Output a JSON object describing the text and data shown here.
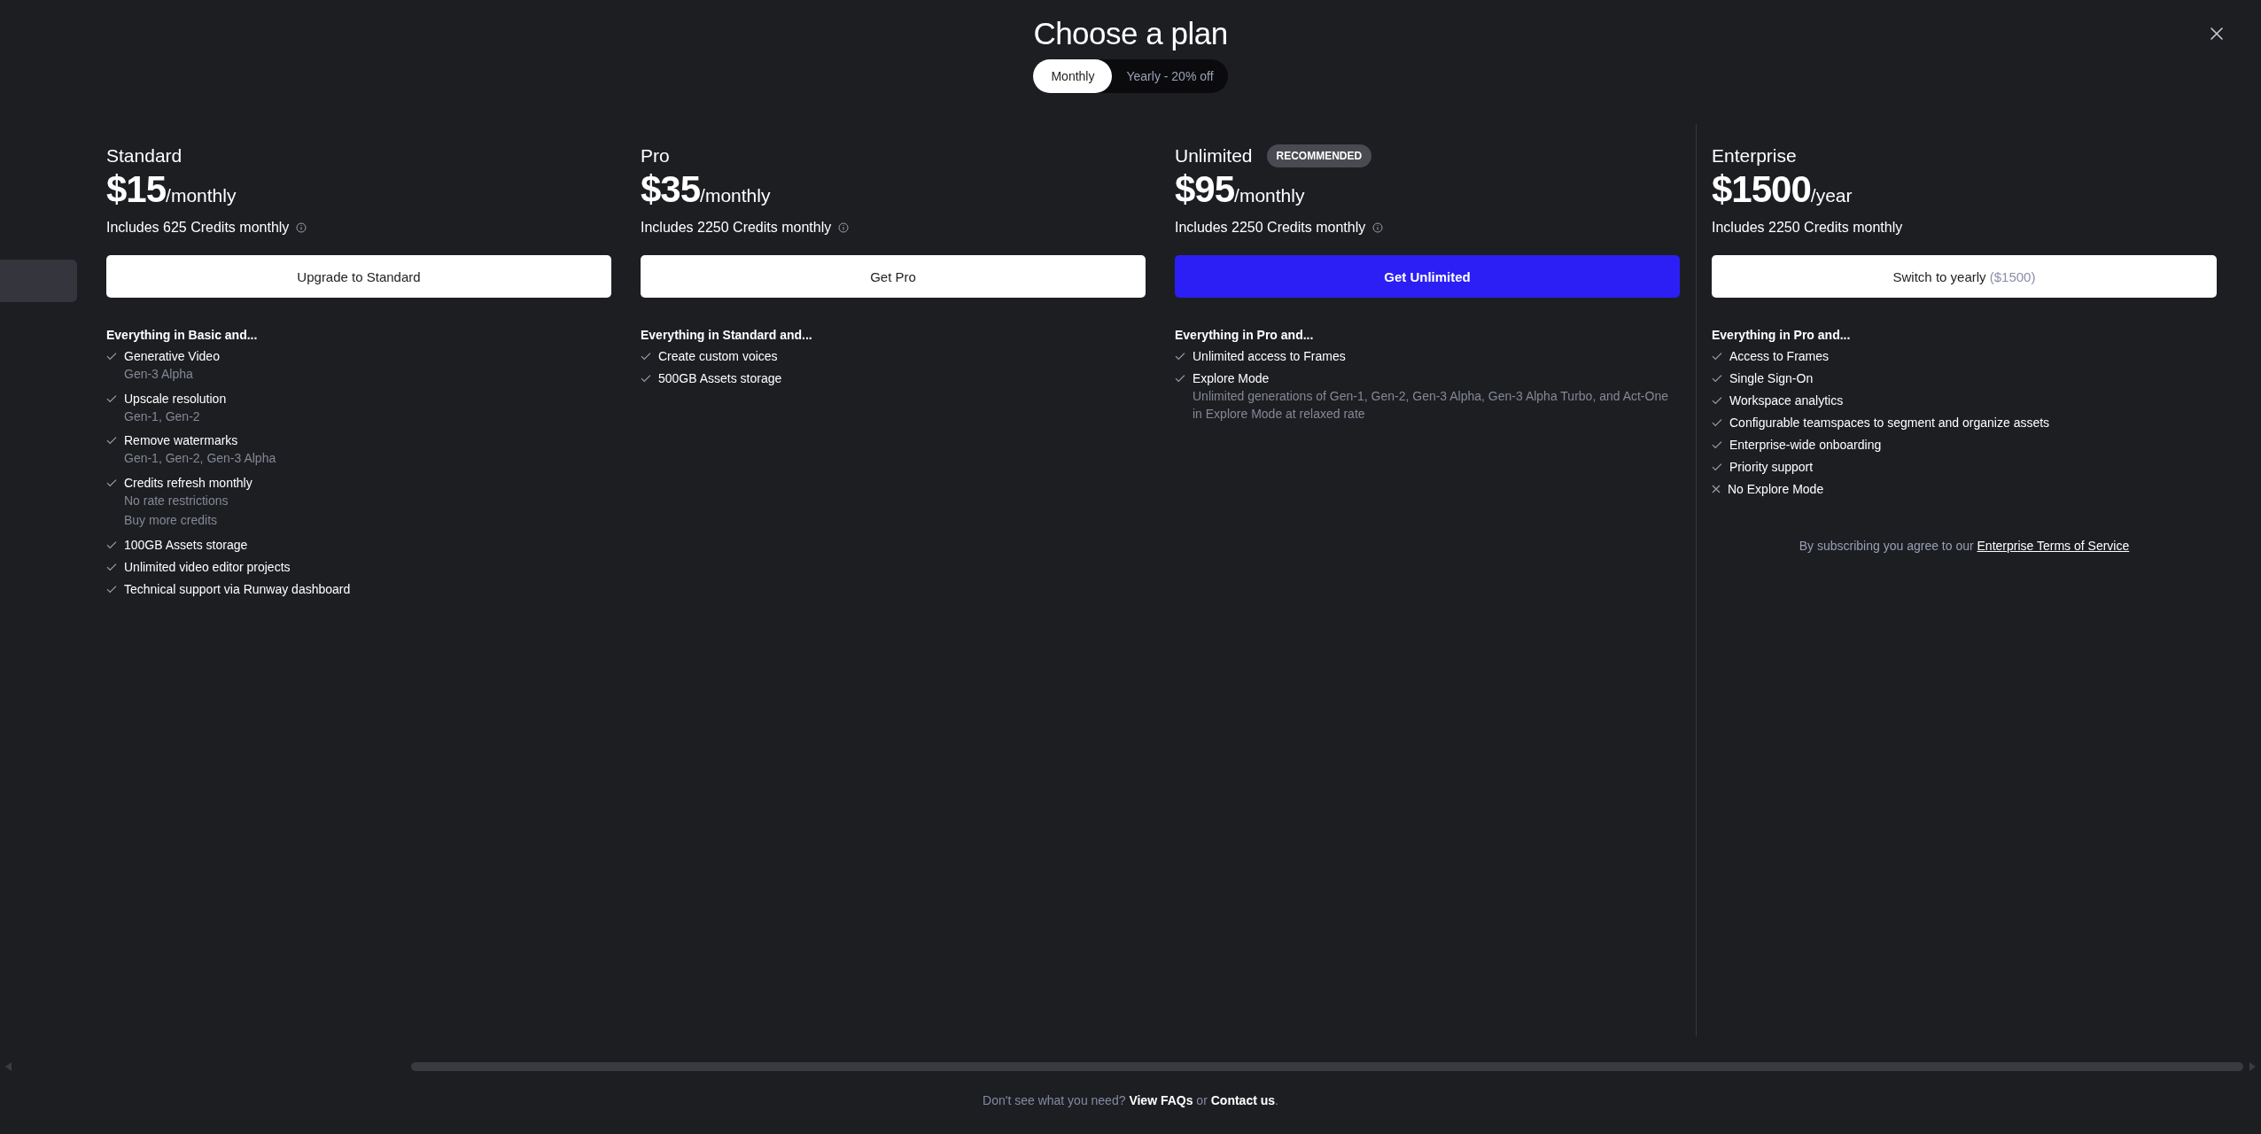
{
  "dialog": {
    "title": "Choose a plan"
  },
  "billing_toggle": [
    {
      "label": "Monthly",
      "selected": true
    },
    {
      "label": "Yearly - 20% off",
      "selected": false
    }
  ],
  "plans": [
    {
      "name": "Standard",
      "price": "$15",
      "period": "/monthly",
      "credits": "Includes 625 Credits monthly",
      "credits_info": true,
      "button": {
        "label": "Upgrade to Standard",
        "highlighted": false
      },
      "features_heading": "Everything in Basic and...",
      "features": [
        {
          "text": "Generative Video",
          "details": [
            "Gen-3 Alpha"
          ],
          "included": true
        },
        {
          "text": "Upscale resolution",
          "details": [
            "Gen-1, Gen-2"
          ],
          "included": true
        },
        {
          "text": "Remove watermarks",
          "details": [
            "Gen-1, Gen-2, Gen-3 Alpha"
          ],
          "included": true
        },
        {
          "text": "Credits refresh monthly",
          "details": [
            "No rate restrictions",
            "Buy more credits"
          ],
          "included": true
        },
        {
          "text": "100GB Assets storage",
          "included": true
        },
        {
          "text": "Unlimited video editor projects",
          "included": true
        },
        {
          "text": "Technical support via Runway dashboard",
          "included": true
        }
      ]
    },
    {
      "name": "Pro",
      "price": "$35",
      "period": "/monthly",
      "credits": "Includes 2250 Credits monthly",
      "credits_info": true,
      "button": {
        "label": "Get Pro",
        "highlighted": false
      },
      "features_heading": "Everything in Standard and...",
      "features": [
        {
          "text": "Create custom voices",
          "included": true
        },
        {
          "text": "500GB Assets storage",
          "included": true
        }
      ]
    },
    {
      "name": "Unlimited",
      "badge": "RECOMMENDED",
      "price": "$95",
      "period": "/monthly",
      "credits": "Includes 2250 Credits monthly",
      "credits_info": true,
      "button": {
        "label": "Get Unlimited",
        "highlighted": true
      },
      "features_heading": "Everything in Pro and...",
      "features": [
        {
          "text": "Unlimited access to Frames",
          "included": true
        },
        {
          "text": "Explore Mode",
          "details": [
            "Unlimited generations of Gen-1, Gen-2, Gen-3 Alpha, Gen-3 Alpha Turbo, and Act-One in Explore Mode at relaxed rate"
          ],
          "included": true
        }
      ]
    },
    {
      "name": "Enterprise",
      "price": "$1500",
      "period": "/year",
      "credits": "Includes 2250 Credits monthly",
      "credits_info": false,
      "button": {
        "label": "Switch to yearly",
        "note": "($1500)",
        "highlighted": false
      },
      "features_heading": "Everything in Pro and...",
      "features": [
        {
          "text": "Access to Frames",
          "included": true
        },
        {
          "text": "Single Sign-On",
          "included": true
        },
        {
          "text": "Workspace analytics",
          "included": true
        },
        {
          "text": "Configurable teamspaces to segment and organize assets",
          "included": true
        },
        {
          "text": "Enterprise-wide onboarding",
          "included": true
        },
        {
          "text": "Priority support",
          "included": true
        },
        {
          "text": "No Explore Mode",
          "included": false
        }
      ],
      "terms": {
        "text": "By subscribing you agree to our",
        "link": "Enterprise Terms of Service"
      }
    }
  ],
  "footer": {
    "text_before": "Don't see what you need?",
    "link_1": "View FAQs",
    "text_between": "or",
    "link_2": "Contact us",
    "text_after": "."
  }
}
